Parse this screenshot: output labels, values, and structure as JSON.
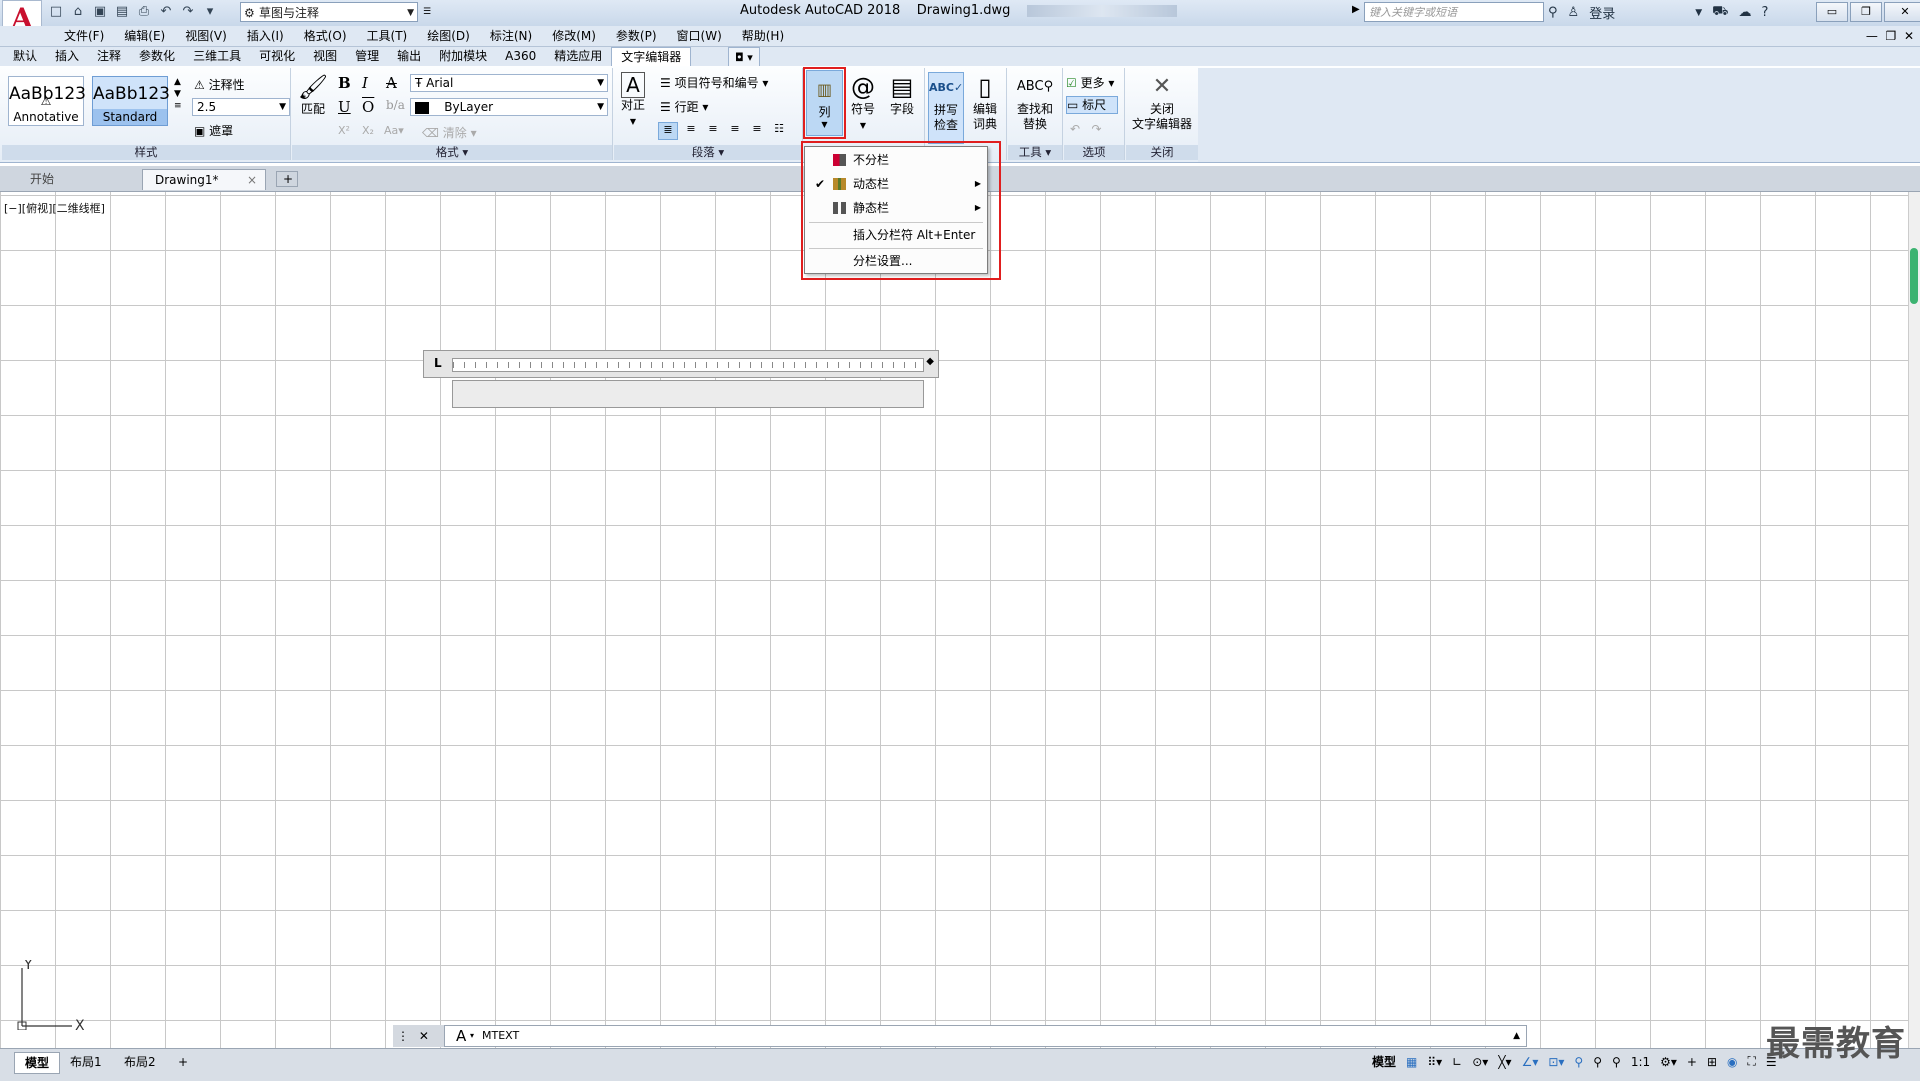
{
  "titlebar": {
    "logo": "A",
    "workspace": "草图与注释",
    "app_title": "Autodesk AutoCAD 2018",
    "file_name": "Drawing1.dwg",
    "search_placeholder": "键入关键字或短语",
    "login": "登录",
    "win_min": "▭",
    "win_restore": "❐",
    "win_close": "✕"
  },
  "menubar": {
    "items": [
      "文件(F)",
      "编辑(E)",
      "视图(V)",
      "插入(I)",
      "格式(O)",
      "工具(T)",
      "绘图(D)",
      "标注(N)",
      "修改(M)",
      "参数(P)",
      "窗口(W)",
      "帮助(H)"
    ]
  },
  "ribbon_tabs": {
    "items": [
      "默认",
      "插入",
      "注释",
      "参数化",
      "三维工具",
      "可视化",
      "视图",
      "管理",
      "输出",
      "附加模块",
      "A360",
      "精选应用",
      "文字编辑器"
    ],
    "active_index": 12
  },
  "ribbon": {
    "style_panel": {
      "title": "样式",
      "style1_sample": "AaBb123",
      "style1_name": "Annotative",
      "style2_sample": "AaBb123",
      "style2_name": "Standard",
      "annotative_label": "注释性",
      "height_value": "2.5",
      "mask_label": "遮罩"
    },
    "format_panel": {
      "title": "格式",
      "match_label": "匹配",
      "font_value": "Arial",
      "color_value": "ByLayer",
      "clear_label": "清除"
    },
    "paragraph_panel": {
      "title": "段落",
      "justify_label": "对正",
      "bullets_label": "项目符号和编号",
      "linespacing_label": "行距"
    },
    "insert_panel": {
      "columns_label": "列",
      "symbol_label": "符号",
      "field_label": "字段"
    },
    "spell_panel": {
      "spell_label_1": "拼写",
      "spell_label_2": "检查",
      "dict_label_1": "编辑",
      "dict_label_2": "词典"
    },
    "tools_panel": {
      "title": "工具",
      "find_label_1": "查找和",
      "find_label_2": "替换"
    },
    "options_panel": {
      "title": "选项",
      "more_label": "更多",
      "ruler_label": "标尺"
    },
    "close_panel": {
      "title": "关闭",
      "close_label_1": "关闭",
      "close_label_2": "文字编辑器"
    }
  },
  "file_tabs": {
    "start": "开始",
    "drawing": "Drawing1*",
    "close": "×",
    "add": "+"
  },
  "viewport_label": "[−][俯视][二维线框]",
  "columns_menu": {
    "items": [
      {
        "label": "不分栏",
        "checked": false,
        "submenu": false
      },
      {
        "label": "动态栏",
        "checked": true,
        "submenu": true
      },
      {
        "label": "静态栏",
        "checked": false,
        "submenu": true
      },
      {
        "label": "插入分栏符 Alt+Enter",
        "checked": false,
        "submenu": false
      },
      {
        "label": "分栏设置...",
        "checked": false,
        "submenu": false
      }
    ]
  },
  "command_line": {
    "prompt": "MTEXT"
  },
  "ucs": {
    "x": "X",
    "y": "Y"
  },
  "layout_tabs": [
    "模型",
    "布局1",
    "布局2"
  ],
  "status": {
    "model": "模型",
    "scale": "1:1"
  },
  "watermark": "最需教育",
  "colors": {
    "highlight_red": "#e01e1e",
    "ucs_green": "#3cb371"
  }
}
